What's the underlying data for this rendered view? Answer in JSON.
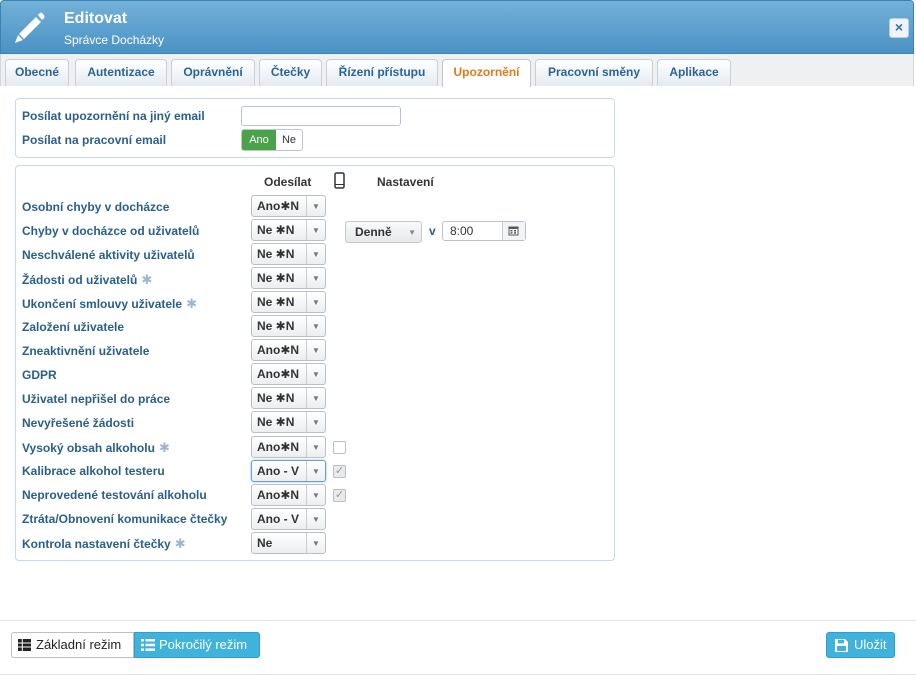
{
  "header": {
    "title": "Editovat",
    "subtitle": "Správce Docházky",
    "close_label": "×"
  },
  "tabs": [
    {
      "label": "Obecné",
      "active": false
    },
    {
      "label": "Autentizace",
      "active": false
    },
    {
      "label": "Oprávnění",
      "active": false
    },
    {
      "label": "Čtečky",
      "active": false
    },
    {
      "label": "Řízení přístupu",
      "active": false
    },
    {
      "label": "Upozornění",
      "active": true
    },
    {
      "label": "Pracovní směny",
      "active": false
    },
    {
      "label": "Aplikace",
      "active": false
    }
  ],
  "email_settings": {
    "other_email_label": "Posílat upozornění na jiný email",
    "other_email_value": "",
    "work_email_label": "Posílat na pracovní email",
    "toggle_on": "Ano",
    "toggle_off": "Ne",
    "toggle_selected": "Ano"
  },
  "columns": {
    "send": "Odesílat",
    "phone_icon": "mobile-phone-icon",
    "settings": "Nastavení"
  },
  "notifications": [
    {
      "label": "Osobní chyby v docházce",
      "star": false,
      "value": "Ano✱N",
      "checkbox": null
    },
    {
      "label": "Chyby v docházce od uživatelů",
      "star": false,
      "value": "Ne ✱N",
      "checkbox": null
    },
    {
      "label": "Neschválené aktivity uživatelů",
      "star": false,
      "value": "Ne ✱N",
      "checkbox": null
    },
    {
      "label": "Žádosti od uživatelů",
      "star": true,
      "value": "Ne ✱N",
      "checkbox": null
    },
    {
      "label": "Ukončení smlouvy uživatele",
      "star": true,
      "value": "Ne ✱N",
      "checkbox": null
    },
    {
      "label": "Založení uživatele",
      "star": false,
      "value": "Ne ✱N",
      "checkbox": null
    },
    {
      "label": "Zneaktivnění uživatele",
      "star": false,
      "value": "Ano✱N",
      "checkbox": null
    },
    {
      "label": "GDPR",
      "star": false,
      "value": "Ano✱N",
      "checkbox": null
    },
    {
      "label": "Uživatel nepřišel do práce",
      "star": false,
      "value": "Ne ✱N",
      "checkbox": null
    },
    {
      "label": "Nevyřešené žádosti",
      "star": false,
      "value": "Ne ✱N",
      "checkbox": null
    },
    {
      "label": "Vysoký obsah alkoholu",
      "star": true,
      "value": "Ano✱N",
      "checkbox": "unchecked"
    },
    {
      "label": "Kalibrace alkohol testeru",
      "star": false,
      "value": "Ano - V",
      "checkbox": "checked",
      "focused": true
    },
    {
      "label": "Neprovedené testování alkoholu",
      "star": false,
      "value": "Ano✱N",
      "checkbox": "checked"
    },
    {
      "label": "Ztráta/Obnovení komunikace čtečky",
      "star": false,
      "value": "Ano - V",
      "checkbox": null
    },
    {
      "label": "Kontrola nastavení čtečky",
      "star": true,
      "value": "Ne",
      "checkbox": null
    }
  ],
  "schedule": {
    "frequency": "Denně",
    "at_label": "v",
    "time": "8:00"
  },
  "footer": {
    "basic_mode": "Základní režim",
    "advanced_mode": "Pokročilý režim",
    "save": "Uložit"
  },
  "colors": {
    "header": "#4a92c4",
    "active_tab": "#e07b1a",
    "label": "#2a5f8c",
    "toggle_on": "#4aa34a",
    "primary_button": "#3fb3db"
  }
}
